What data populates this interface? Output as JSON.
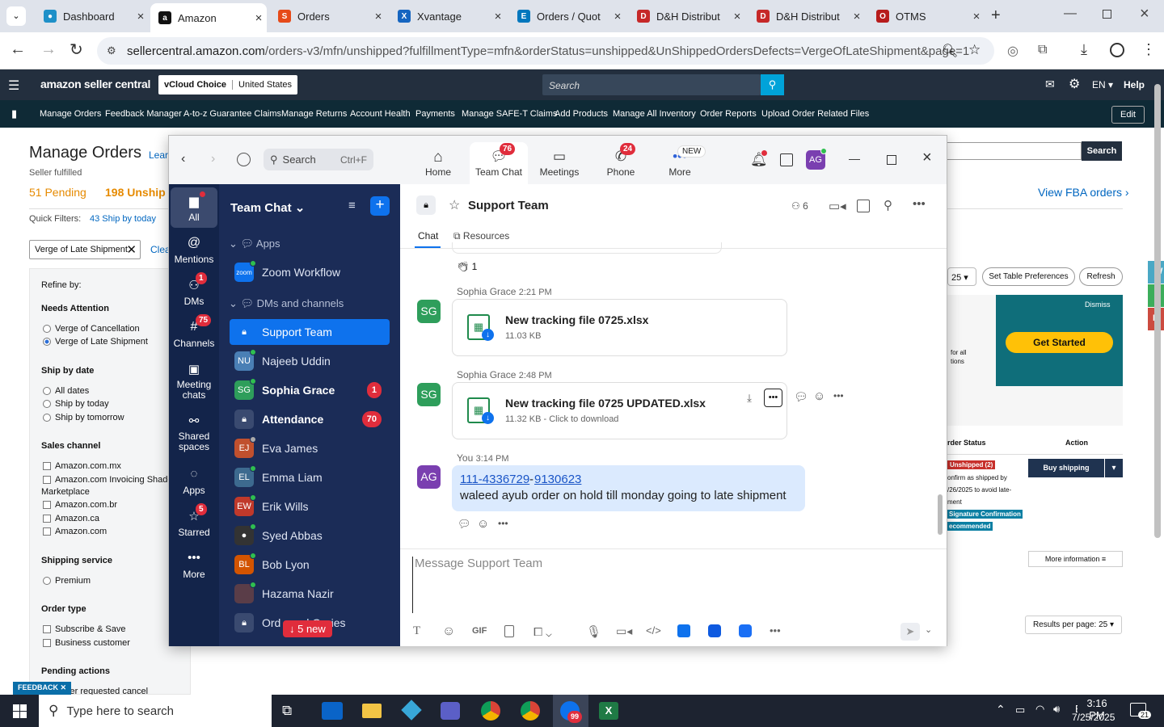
{
  "browser": {
    "tabs": [
      {
        "title": "Dashboard",
        "icon": "green"
      },
      {
        "title": "Amazon",
        "icon": "amazon"
      },
      {
        "title": "Orders",
        "icon": "orders"
      },
      {
        "title": "Xvantage",
        "icon": "x"
      },
      {
        "title": "Orders / Quot",
        "icon": "ec"
      },
      {
        "title": "D&H Distribut",
        "icon": "dh"
      },
      {
        "title": "D&H Distribut",
        "icon": "dh"
      },
      {
        "title": "OTMS",
        "icon": "otms"
      }
    ],
    "url_host": "sellercentral.amazon.com",
    "url_path": "/orders-v3/mfn/unshipped?fulfillmentType=mfn&orderStatus=unshipped&UnShippedOrdersDefects=VergeOfLateShipment&page=1"
  },
  "amazon": {
    "logo": "amazon seller central",
    "store": "vCloud Choice",
    "region": "United States",
    "search_placeholder": "Search",
    "lang": "EN",
    "help": "Help",
    "nav": [
      "Manage Orders",
      "Feedback Manager",
      "A-to-z Guarantee Claims",
      "Manage Returns",
      "Account Health",
      "Payments",
      "Manage SAFE-T Claims",
      "Add Products",
      "Manage All Inventory",
      "Order Reports",
      "Upload Order Related Files"
    ],
    "edit": "Edit",
    "page_title": "Manage Orders",
    "learn": "Lear",
    "seller_fulfilled": "Seller fulfilled",
    "pending": "51 Pending",
    "unshipped": "198 Unship",
    "quick_filters": "Quick Filters:",
    "ship_today": "43 Ship by today",
    "filter_chip": "Verge of Late Shipment",
    "clear": "Clea",
    "refine_by": "Refine by:",
    "needs_attention": "Needs Attention",
    "na_opts": [
      "Verge of Cancellation",
      "Verge of Late Shipment"
    ],
    "ship_by_date": "Ship by date",
    "sbd_opts": [
      "All dates",
      "Ship by today",
      "Ship by tomorrow"
    ],
    "sales_channel": "Sales channel",
    "sc_opts": [
      "Amazon.com.mx",
      "Amazon.com Invoicing Shadow",
      "Marketplace",
      "Amazon.com.br",
      "Amazon.ca",
      "Amazon.com"
    ],
    "shipping_service": "Shipping service",
    "ss_opts": [
      "Premium"
    ],
    "order_type": "Order type",
    "ot_opts": [
      "Subscribe & Save",
      "Business customer"
    ],
    "pending_actions": "Pending actions",
    "pa_opts": [
      "ver requested cancel"
    ],
    "feedback": "FEEDBACK",
    "search_btn": "Search",
    "view_fba": "View FBA orders ›",
    "per_page_small": "25",
    "set_table": "Set Table Preferences",
    "refresh": "Refresh",
    "dismiss": "Dismiss",
    "get_started": "Get Started",
    "promo_text_1": "for all",
    "promo_text_2": "tions",
    "col_status": "rder Status",
    "col_action": "Action",
    "status_badge": "Unshipped (2)",
    "status_text_1": "onfirm as shipped by",
    "status_text_2": "/26/2025 to avoid late-",
    "status_text_3": "ment",
    "sig_1": "Signature Confirmation",
    "sig_2": "ecommended",
    "buy_shipping": "Buy shipping",
    "more_info": "More information ≡",
    "results_per_page": "Results per page: 25",
    "edge_tabs": [
      "W",
      "A",
      "In"
    ]
  },
  "zoom": {
    "search": "Search",
    "shortcut": "Ctrl+F",
    "top_nav": [
      {
        "label": "Home",
        "badge": ""
      },
      {
        "label": "Team Chat",
        "badge": "76"
      },
      {
        "label": "Meetings",
        "badge": ""
      },
      {
        "label": "Phone",
        "badge": "24"
      },
      {
        "label": "More",
        "badge": "NEW"
      }
    ],
    "avatar": "AG",
    "rail": [
      {
        "label": "All",
        "badge": ""
      },
      {
        "label": "Mentions",
        "badge": ""
      },
      {
        "label": "DMs",
        "badge": "1"
      },
      {
        "label": "Channels",
        "badge": "75"
      },
      {
        "label": "Meeting chats",
        "badge": ""
      },
      {
        "label": "Shared spaces",
        "badge": ""
      },
      {
        "label": "Apps",
        "badge": ""
      },
      {
        "label": "Starred",
        "badge": "5"
      },
      {
        "label": "More",
        "badge": ""
      }
    ],
    "list_title": "Team Chat",
    "sec_apps": "Apps",
    "zoom_workflow": "Zoom Workflow",
    "sec_dms": "DMs and channels",
    "items": [
      {
        "name": "Support Team",
        "av": "",
        "color": "",
        "bold": false,
        "count": ""
      },
      {
        "name": "Najeeb Uddin",
        "av": "NU",
        "color": "#4a7fb5",
        "bold": false,
        "count": ""
      },
      {
        "name": "Sophia Grace",
        "av": "SG",
        "color": "#2e9e5b",
        "bold": true,
        "count": "1"
      },
      {
        "name": "Attendance",
        "av": "",
        "color": "#3a4a70",
        "bold": true,
        "count": "70"
      },
      {
        "name": "Eva James",
        "av": "EJ",
        "color": "#c0502e",
        "bold": false,
        "count": ""
      },
      {
        "name": "Emma Liam",
        "av": "EL",
        "color": "#3d6a8f",
        "bold": false,
        "count": ""
      },
      {
        "name": "Erik Wills",
        "av": "EW",
        "color": "#c0392b",
        "bold": false,
        "count": ""
      },
      {
        "name": "Syed Abbas",
        "av": "",
        "color": "#333",
        "bold": false,
        "count": ""
      },
      {
        "name": "Bob Lyon",
        "av": "BL",
        "color": "#d35400",
        "bold": false,
        "count": ""
      },
      {
        "name": "Hazama Nazir",
        "av": "",
        "color": "#5a3d48",
        "bold": false,
        "count": ""
      },
      {
        "name": "Ord       d Quries",
        "av": "",
        "color": "#3a4a70",
        "bold": false,
        "count": ""
      }
    ],
    "new_msgs": "↓ 5 new",
    "channel": "Support Team",
    "members": "6",
    "tab_chat": "Chat",
    "tab_resources": "Resources",
    "reaction": "1",
    "msgs": [
      {
        "author": "Sophia Grace",
        "time": "2:21 PM",
        "file": "New tracking file 0725.xlsx",
        "meta": "11.03 KB"
      },
      {
        "author": "Sophia Grace",
        "time": "2:48 PM",
        "file": "New tracking file 0725 UPDATED.xlsx",
        "meta": "11.32 KB - Click to download"
      }
    ],
    "my_author": "You",
    "my_time": "3:14 PM",
    "link1": "111-4336729",
    "link2": "9130623",
    "my_text": "waleed ayub order on hold till monday going to late shipment",
    "compose_placeholder": "Message Support Team",
    "gif": "GIF"
  },
  "taskbar": {
    "search": "Type here to search",
    "time": "3:16 PM",
    "date": "7/25/2025",
    "notif": "21",
    "zoom_badge": "99"
  }
}
